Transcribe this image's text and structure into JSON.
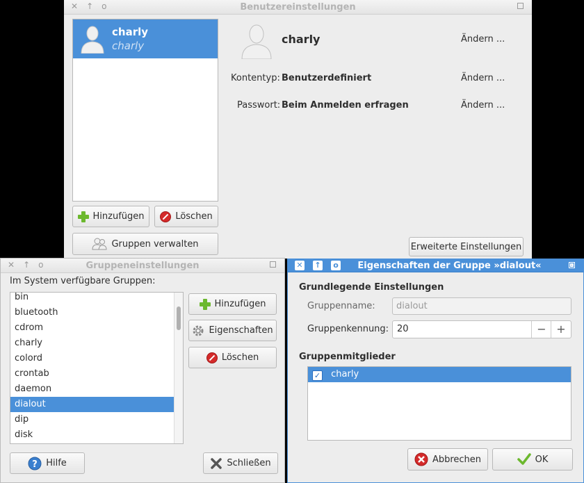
{
  "user_win": {
    "title": "Benutzereinstellungen",
    "user_list": [
      {
        "name": "charly",
        "sub": "charly"
      }
    ],
    "add_label": "Hinzufügen",
    "delete_label": "Löschen",
    "groups_label": "Gruppen verwalten",
    "advanced_label": "Erweiterte Einstellungen",
    "detail_name": "charly",
    "change_label": "Ändern ...",
    "account_type_label": "Kontentyp:",
    "account_type_value": "Benutzerdefiniert",
    "password_label": "Passwort:",
    "password_value": "Beim Anmelden erfragen"
  },
  "groups_win": {
    "title": "Gruppeneinstellungen",
    "available_label": "Im System verfügbare Gruppen:",
    "groups": [
      "bin",
      "bluetooth",
      "cdrom",
      "charly",
      "colord",
      "crontab",
      "daemon",
      "dialout",
      "dip",
      "disk"
    ],
    "selected": "dialout",
    "add_label": "Hinzufügen",
    "props_label": "Eigenschaften",
    "delete_label": "Löschen",
    "help_label": "Hilfe",
    "close_label": "Schließen"
  },
  "props_win": {
    "title": "Eigenschaften der Gruppe »dialout«",
    "basic_heading": "Grundlegende Einstellungen",
    "name_label": "Gruppenname:",
    "name_value": "dialout",
    "id_label": "Gruppenkennung:",
    "id_value": "20",
    "members_heading": "Gruppenmitglieder",
    "members": [
      {
        "name": "charly",
        "checked": true
      }
    ],
    "cancel_label": "Abbrechen",
    "ok_label": "OK"
  },
  "colors": {
    "selection": "#4a90d9",
    "window_bg": "#ededed"
  }
}
